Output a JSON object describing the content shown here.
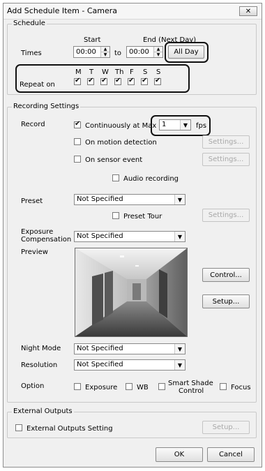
{
  "window": {
    "title": "Add Schedule Item - Camera",
    "close_icon": "close-icon"
  },
  "schedule": {
    "legend": "Schedule",
    "start_label": "Start",
    "end_label": "End (Next Day)",
    "times_label": "Times",
    "start_time": "00:00",
    "to_label": "to",
    "end_time": "00:00",
    "all_day_label": "All Day",
    "repeat_label": "Repeat on",
    "days": [
      "M",
      "T",
      "W",
      "Th",
      "F",
      "S",
      "S"
    ],
    "days_checked": [
      true,
      true,
      true,
      true,
      true,
      true,
      true
    ]
  },
  "recording": {
    "legend": "Recording Settings",
    "record_label": "Record",
    "continuous_label": "Continuously at Max",
    "continuous_checked": true,
    "fps_value": "1",
    "fps_label": "fps",
    "motion_label": "On motion detection",
    "motion_checked": false,
    "sensor_label": "On sensor event",
    "sensor_checked": false,
    "audio_label": "Audio recording",
    "audio_checked": false,
    "settings_label": "Settings...",
    "preset_label": "Preset",
    "preset_value": "Not Specified",
    "preset_tour_label": "Preset Tour",
    "preset_tour_checked": false,
    "exposure_label_1": "Exposure",
    "exposure_label_2": "Compensation",
    "exposure_value": "Not Specified",
    "preview_label": "Preview",
    "control_label": "Control...",
    "setup_label": "Setup...",
    "night_label": "Night Mode",
    "night_value": "Not Specified",
    "resolution_label": "Resolution",
    "resolution_value": "Not Specified",
    "option_label": "Option",
    "opt_exposure": "Exposure",
    "opt_wb": "WB",
    "opt_smart_1": "Smart Shade",
    "opt_smart_2": "Control",
    "opt_focus": "Focus"
  },
  "external": {
    "legend": "External Outputs",
    "setting_label": "External Outputs Setting",
    "setting_checked": false,
    "setup_label": "Setup..."
  },
  "footer": {
    "ok_label": "OK",
    "cancel_label": "Cancel"
  }
}
